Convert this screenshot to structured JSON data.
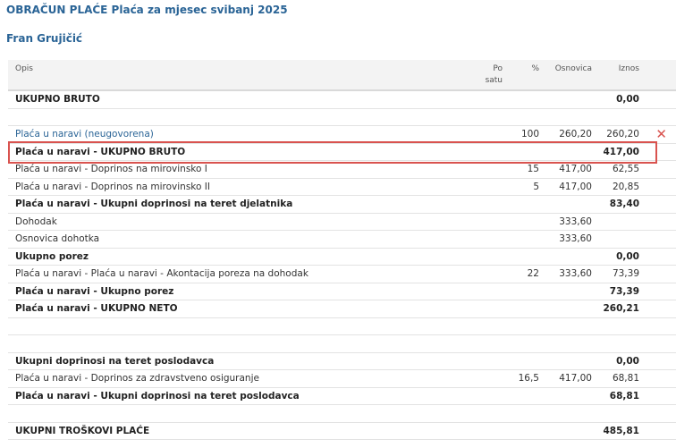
{
  "page": {
    "title": "OBRAČUN PLAĆE Plaća za mjesec svibanj 2025",
    "employee": "Fran Grujičić"
  },
  "table": {
    "headers": {
      "desc": "Opis",
      "rate_line1": "Po",
      "rate_line2": "satu",
      "pct": "%",
      "base": "Osnovica",
      "amount": "Iznos"
    },
    "rows": [
      {
        "desc": "UKUPNO BRUTO",
        "rate": "",
        "pct": "",
        "base": "",
        "amount": "0,00",
        "bold": true
      },
      {
        "desc": "",
        "rate": "",
        "pct": "",
        "base": "",
        "amount": "",
        "blank": true
      },
      {
        "desc": "Plaća u naravi (neugovorena)",
        "rate": "",
        "pct": "100",
        "base": "260,20",
        "amount": "260,20",
        "link": true,
        "deletable": true
      },
      {
        "desc": "Plaća u naravi - UKUPNO BRUTO",
        "rate": "",
        "pct": "",
        "base": "",
        "amount": "417,00",
        "bold": true
      },
      {
        "desc": "Plaća u naravi - Doprinos na mirovinsko I",
        "rate": "",
        "pct": "15",
        "base": "417,00",
        "amount": "62,55"
      },
      {
        "desc": "Plaća u naravi - Doprinos na mirovinsko II",
        "rate": "",
        "pct": "5",
        "base": "417,00",
        "amount": "20,85"
      },
      {
        "desc": "Plaća u naravi - Ukupni doprinosi na teret djelatnika",
        "rate": "",
        "pct": "",
        "base": "",
        "amount": "83,40",
        "bold": true
      },
      {
        "desc": "Dohodak",
        "rate": "",
        "pct": "",
        "base": "333,60",
        "amount": ""
      },
      {
        "desc": "Osnovica dohotka",
        "rate": "",
        "pct": "",
        "base": "333,60",
        "amount": ""
      },
      {
        "desc": "Ukupno porez",
        "rate": "",
        "pct": "",
        "base": "",
        "amount": "0,00",
        "bold": true
      },
      {
        "desc": "Plaća u naravi - Plaća u naravi - Akontacija poreza na dohodak",
        "rate": "",
        "pct": "22",
        "base": "333,60",
        "amount": "73,39"
      },
      {
        "desc": "Plaća u naravi - Ukupno porez",
        "rate": "",
        "pct": "",
        "base": "",
        "amount": "73,39",
        "bold": true
      },
      {
        "desc": "Plaća u naravi - UKUPNO NETO",
        "rate": "",
        "pct": "",
        "base": "",
        "amount": "260,21",
        "bold": true
      },
      {
        "desc": "",
        "rate": "",
        "pct": "",
        "base": "",
        "amount": "",
        "blank": true
      },
      {
        "desc": "",
        "rate": "",
        "pct": "",
        "base": "",
        "amount": "",
        "blank": true
      },
      {
        "desc": "Ukupni doprinosi na teret poslodavca",
        "rate": "",
        "pct": "",
        "base": "",
        "amount": "0,00",
        "bold": true
      },
      {
        "desc": "Plaća u naravi - Doprinos za zdravstveno osiguranje",
        "rate": "",
        "pct": "16,5",
        "base": "417,00",
        "amount": "68,81"
      },
      {
        "desc": "Plaća u naravi - Ukupni doprinosi na teret poslodavca",
        "rate": "",
        "pct": "",
        "base": "",
        "amount": "68,81",
        "bold": true
      },
      {
        "desc": "",
        "rate": "",
        "pct": "",
        "base": "",
        "amount": "",
        "blank": true
      },
      {
        "desc": "UKUPNI TROŠKOVI PLAĆE",
        "rate": "",
        "pct": "",
        "base": "",
        "amount": "485,81",
        "bold": true
      }
    ],
    "delete_icon": "close-icon",
    "delete_glyph": "✕"
  },
  "colors": {
    "heading": "#2a6496",
    "highlight_border": "#d9534f",
    "delete_icon": "#d9534f"
  }
}
